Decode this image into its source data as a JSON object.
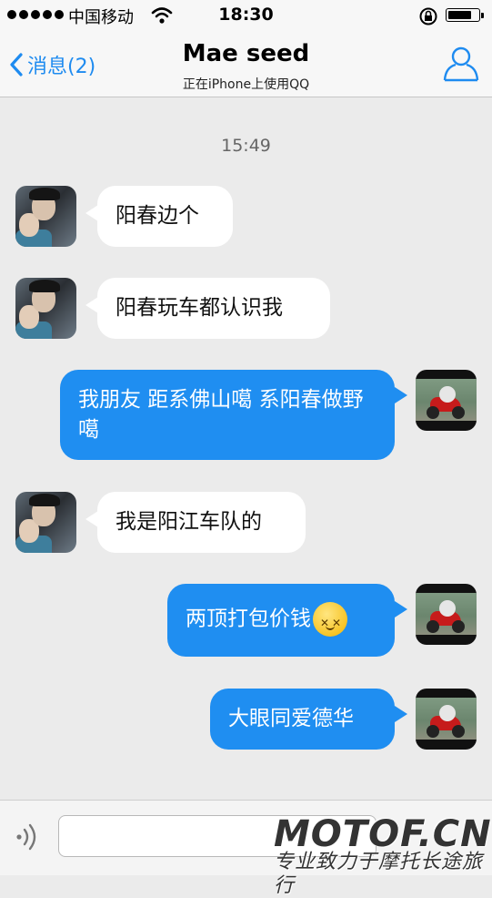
{
  "status_bar": {
    "carrier": "中国移动",
    "time": "18:30",
    "battery_level": 0.8
  },
  "nav": {
    "back_label": "消息(2)",
    "title": "Mae seed",
    "subtitle": "正在iPhone上使用QQ"
  },
  "chat": {
    "timestamp": "15:49",
    "messages": [
      {
        "direction": "incoming",
        "text": "阳春边个"
      },
      {
        "direction": "incoming",
        "text": "阳春玩车都认识我"
      },
      {
        "direction": "outgoing",
        "text": "我朋友 距系佛山噶 系阳春做野噶"
      },
      {
        "direction": "incoming",
        "text": "我是阳江车队的"
      },
      {
        "direction": "outgoing",
        "text": "两顶打包价钱",
        "emoji": "dizzy-face-emoji"
      },
      {
        "direction": "outgoing",
        "text": "大眼同爱德华"
      }
    ]
  },
  "input": {
    "placeholder": ""
  },
  "watermark": {
    "main": "MOTOF.CN",
    "sub": "专业致力于摩托长途旅行"
  },
  "colors": {
    "accent": "#1e8bf0",
    "outgoing_bubble": "#1f8ef1",
    "incoming_bubble": "#ffffff",
    "background": "#ebebeb"
  }
}
